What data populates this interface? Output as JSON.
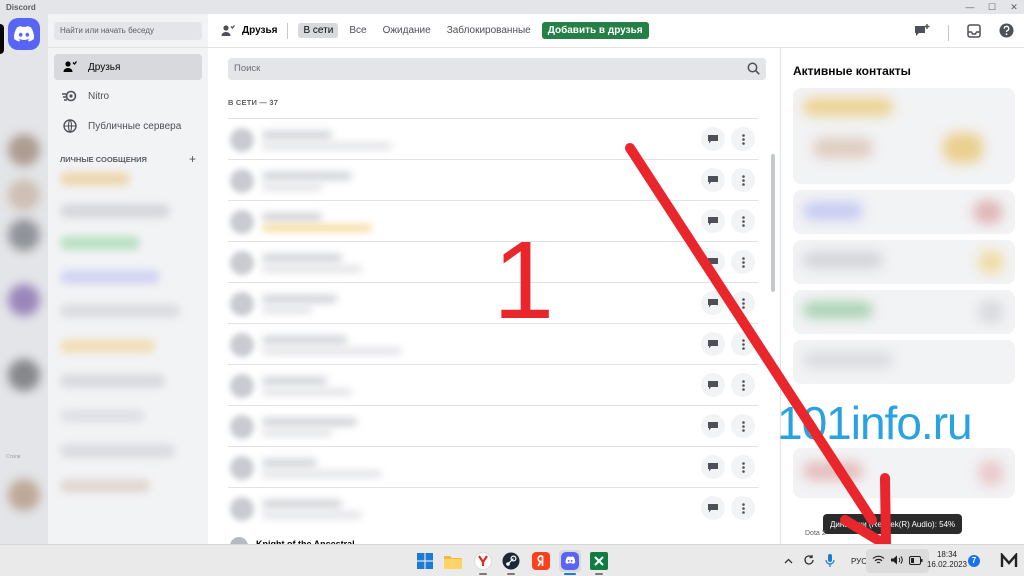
{
  "window": {
    "title": "Discord",
    "controls": [
      "—",
      "☐",
      "✕"
    ]
  },
  "sidebar": {
    "search_placeholder": "Найти или начать беседу",
    "items": [
      {
        "label": "Друзья",
        "icon": "friends-icon"
      },
      {
        "label": "Nitro",
        "icon": "nitro-icon"
      },
      {
        "label": "Публичные сервера",
        "icon": "compass-icon"
      }
    ],
    "dm_header": "ЛИЧНЫЕ СООБЩЕНИЯ",
    "dm_add": "+"
  },
  "rail": {
    "label": "Стили"
  },
  "topbar": {
    "title": "Друзья",
    "tabs": [
      {
        "label": "В сети",
        "active": true
      },
      {
        "label": "Все",
        "active": false
      },
      {
        "label": "Ожидание",
        "active": false
      },
      {
        "label": "Заблокированные",
        "active": false
      }
    ],
    "add_friend": "Добавить в друзья"
  },
  "friends": {
    "search_placeholder": "Поиск",
    "online_count": "В СЕТИ — 37",
    "last_visible_name": "Knight of the Ancestral..."
  },
  "active_contacts": {
    "title": "Активные контакты"
  },
  "tooltip": {
    "text": "Динамики (Realtek(R) Audio): 54%",
    "activity": "Dota 2"
  },
  "overlay": {
    "number": "1",
    "watermark": "101info.ru"
  },
  "taskbar": {
    "apps": [
      "windows-start",
      "file-explorer",
      "yandex-browser",
      "steam",
      "yandex",
      "discord",
      "excel"
    ],
    "language": "РУС",
    "time": "18:34",
    "date": "16.02.2023",
    "notification_count": "7"
  },
  "colors": {
    "blurple": "#5865f2",
    "green": "#248046",
    "watermark": "#29a3e0",
    "arrow": "#e8262c"
  }
}
